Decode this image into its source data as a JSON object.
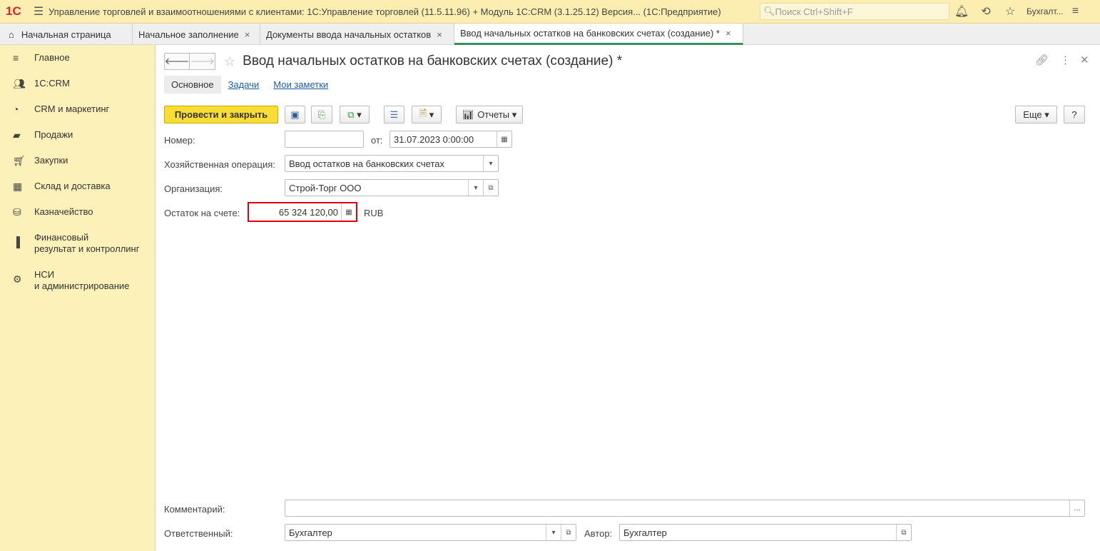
{
  "topbar": {
    "logo": "1С",
    "title": "Управление торговлей и взаимоотношениями с клиентами: 1С:Управление торговлей (11.5.11.96) + Модуль 1С:CRM (3.1.25.12) Версия... (1С:Предприятие)",
    "search_placeholder": "Поиск Ctrl+Shift+F",
    "user": "Бухгалт..."
  },
  "tabs": [
    {
      "label": "Начальная страница"
    },
    {
      "label": "Начальное заполнение"
    },
    {
      "label": "Документы ввода начальных остатков"
    },
    {
      "label": "Ввод начальных остатков на банковских счетах (создание) *"
    }
  ],
  "sidebar": {
    "items": [
      {
        "label": "Главное",
        "icon": "menu-icon"
      },
      {
        "label": "1С:CRM",
        "icon": "users-icon"
      },
      {
        "label": "CRM и маркетинг",
        "icon": "pie-icon"
      },
      {
        "label": "Продажи",
        "icon": "bag-icon"
      },
      {
        "label": "Закупки",
        "icon": "cart-icon"
      },
      {
        "label": "Склад и доставка",
        "icon": "grid-icon"
      },
      {
        "label": "Казначейство",
        "icon": "coins-icon"
      },
      {
        "label": "Финансовый\nрезультат и контроллинг",
        "icon": "chart-icon"
      },
      {
        "label": "НСИ\nи администрирование",
        "icon": "gear-icon"
      }
    ]
  },
  "form": {
    "title": "Ввод начальных остатков на банковских счетах (создание) *",
    "tabs": [
      "Основное",
      "Задачи",
      "Мои заметки"
    ],
    "toolbar": {
      "post_close": "Провести и закрыть",
      "reports": "Отчеты",
      "more": "Еще",
      "help": "?"
    },
    "fields": {
      "number_label": "Номер:",
      "number_value": "",
      "date_label": "от:",
      "date_value": "31.07.2023  0:00:00",
      "operation_label": "Хозяйственная операция:",
      "operation_value": "Ввод остатков на банковских счетах",
      "org_label": "Организация:",
      "org_value": "Строй-Торг ООО",
      "balance_label": "Остаток на счете:",
      "balance_value": "65 324 120,00",
      "currency": "RUB",
      "comment_label": "Комментарий:",
      "comment_value": "",
      "responsible_label": "Ответственный:",
      "responsible_value": "Бухгалтер",
      "author_label": "Автор:",
      "author_value": "Бухгалтер"
    }
  },
  "colors": {
    "highlight": "#e3000f",
    "primary_button": "#f9dc34",
    "sidebar": "#fbf1b9"
  }
}
